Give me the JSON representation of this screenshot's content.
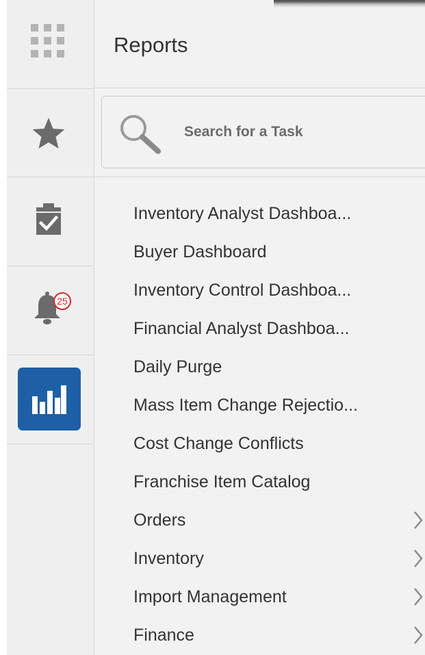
{
  "header": {
    "title": "Reports"
  },
  "search": {
    "placeholder": "Search for a Task",
    "value": ""
  },
  "rail": {
    "items": [
      {
        "name": "apps",
        "icon": "grid-icon"
      },
      {
        "name": "favorites",
        "icon": "star-icon"
      },
      {
        "name": "tasks",
        "icon": "clipboard-check-icon"
      },
      {
        "name": "notifications",
        "icon": "bell-icon",
        "badge": "25"
      },
      {
        "name": "reports",
        "icon": "bar-chart-icon",
        "active": true
      }
    ]
  },
  "menu": {
    "items": [
      {
        "label": "Inventory Analyst Dashboa...",
        "has_children": false
      },
      {
        "label": "Buyer Dashboard",
        "has_children": false
      },
      {
        "label": "Inventory Control Dashboa...",
        "has_children": false
      },
      {
        "label": "Financial Analyst Dashboa...",
        "has_children": false
      },
      {
        "label": "Daily Purge",
        "has_children": false
      },
      {
        "label": "Mass Item Change Rejectio...",
        "has_children": false
      },
      {
        "label": "Cost Change Conflicts",
        "has_children": false
      },
      {
        "label": "Franchise Item Catalog",
        "has_children": false
      },
      {
        "label": "Orders",
        "has_children": true
      },
      {
        "label": "Inventory",
        "has_children": true
      },
      {
        "label": "Import Management",
        "has_children": true
      },
      {
        "label": "Finance",
        "has_children": true
      }
    ]
  },
  "colors": {
    "accent": "#1e5fa6",
    "badge": "#e0242a",
    "icon": "#6b6b6b",
    "background": "#f2f2f2"
  }
}
